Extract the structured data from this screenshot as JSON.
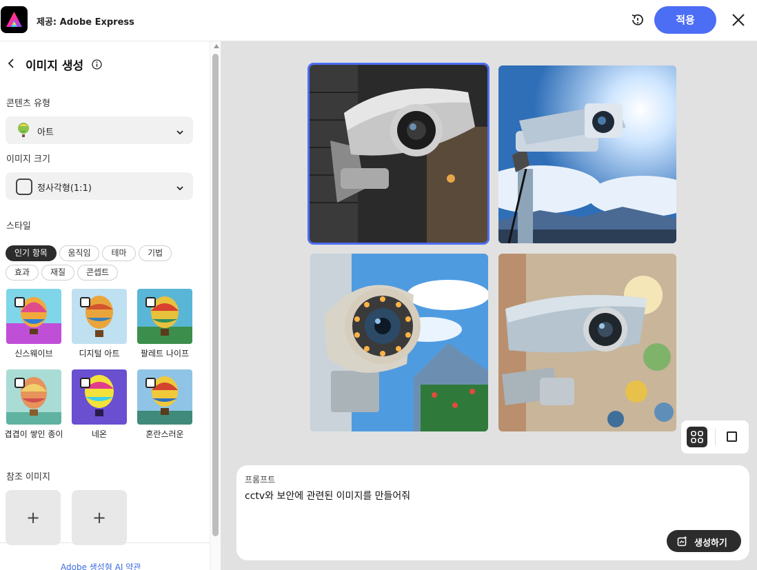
{
  "header": {
    "app_title": "제공: Adobe Express",
    "apply_label": "적용",
    "accent_color": "#4c6ef5"
  },
  "panel": {
    "title": "이미지 생성",
    "content_type_label": "콘텐츠 유형",
    "content_type_value": "아트",
    "image_size_label": "이미지 크기",
    "image_size_value": "정사각형(1:1)",
    "style_label": "스타일",
    "style_tabs": [
      "인기 항목",
      "움직임",
      "테마",
      "기법",
      "효과",
      "재질",
      "콘셉트"
    ],
    "active_style_tab": "인기 항목",
    "styles": [
      {
        "label": "신스웨이브",
        "checked": false
      },
      {
        "label": "디지털 아트",
        "checked": false
      },
      {
        "label": "팔레트 나이프",
        "checked": false
      },
      {
        "label": "겹겹이 쌓인 종이",
        "checked": false
      },
      {
        "label": "네온",
        "checked": false
      },
      {
        "label": "혼란스러운",
        "checked": false
      }
    ],
    "reference_label": "참조 이미지",
    "reference_add_label": "+",
    "footer_link": "Adobe 생성형 AI 약관"
  },
  "main": {
    "images": [
      {
        "subject": "cctv-camera-brick-wall",
        "selected": true
      },
      {
        "subject": "cctv-camera-blue-sky",
        "selected": false
      },
      {
        "subject": "cctv-camera-illustration",
        "selected": false
      },
      {
        "subject": "cctv-camera-bokeh",
        "selected": false
      }
    ],
    "view_mode": "grid",
    "prompt_label": "프롬프트",
    "prompt_text": "cctv와 보안에 관련된 이미지를 만들어줘",
    "generate_label": "생성하기"
  }
}
